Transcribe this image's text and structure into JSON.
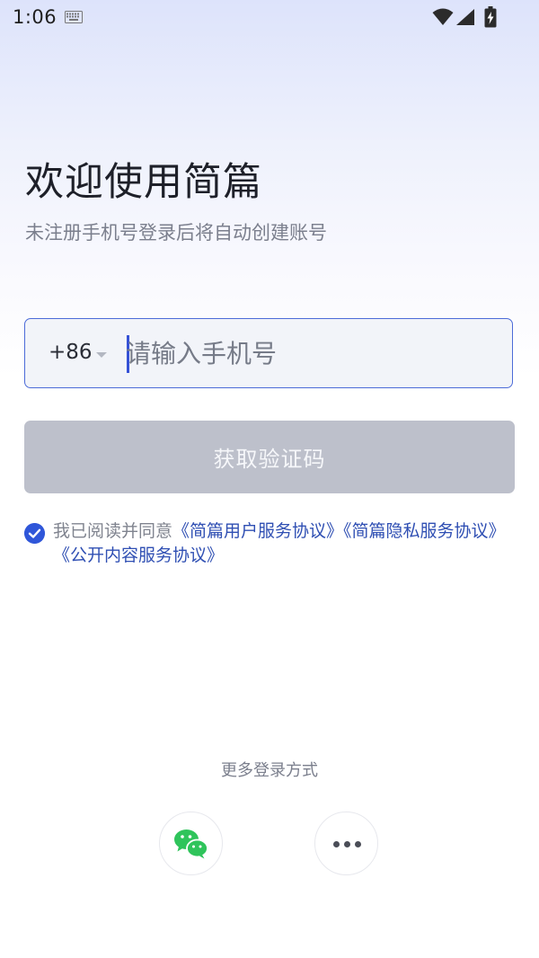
{
  "status_bar": {
    "time": "1:06"
  },
  "header": {
    "title": "欢迎使用简篇",
    "subtitle": "未注册手机号登录后将自动创建账号"
  },
  "phone_login": {
    "country_code": "+86",
    "phone_placeholder": "请输入手机号",
    "get_code_label": "获取验证码"
  },
  "agreement": {
    "checked": true,
    "prefix": "我已阅读并同意",
    "links": [
      "《简篇用户服务协议》",
      "《简篇隐私服务协议》",
      "《公开内容服务协议》"
    ]
  },
  "alt_login": {
    "label": "更多登录方式",
    "options": [
      {
        "icon": "wechat-icon"
      },
      {
        "icon": "more-dots-icon"
      }
    ]
  },
  "colors": {
    "accent": "#2f56d9",
    "button_disabled": "#bdc0cb",
    "link": "#2f4fb3",
    "wechat_green": "#2fc45b"
  }
}
